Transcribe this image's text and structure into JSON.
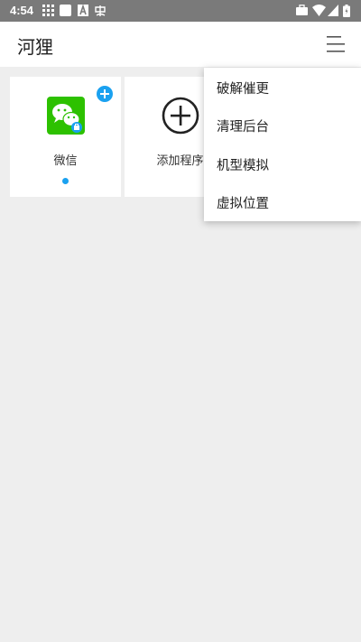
{
  "status_bar": {
    "time": "4:54",
    "icons": [
      "grid-icon",
      "square-icon",
      "font-icon",
      "char-icon",
      "briefcase-icon",
      "wifi-icon",
      "signal-icon",
      "battery-icon"
    ]
  },
  "app_bar": {
    "title": "河狸",
    "menu_icon": "hamburger-menu-icon"
  },
  "apps": [
    {
      "label": "微信",
      "icon": "wechat-icon",
      "badge": "add-badge-icon"
    },
    {
      "label": "添加程序",
      "icon": "add-circle-icon"
    }
  ],
  "dropdown_menu": {
    "items": [
      "破解催更",
      "清理后台",
      "机型模拟",
      "虚拟位置"
    ]
  },
  "colors": {
    "status_bar": "#7a7a7a",
    "background": "#eeeeee",
    "wechat_green": "#2dc100",
    "accent_blue": "#1aa1f0"
  }
}
